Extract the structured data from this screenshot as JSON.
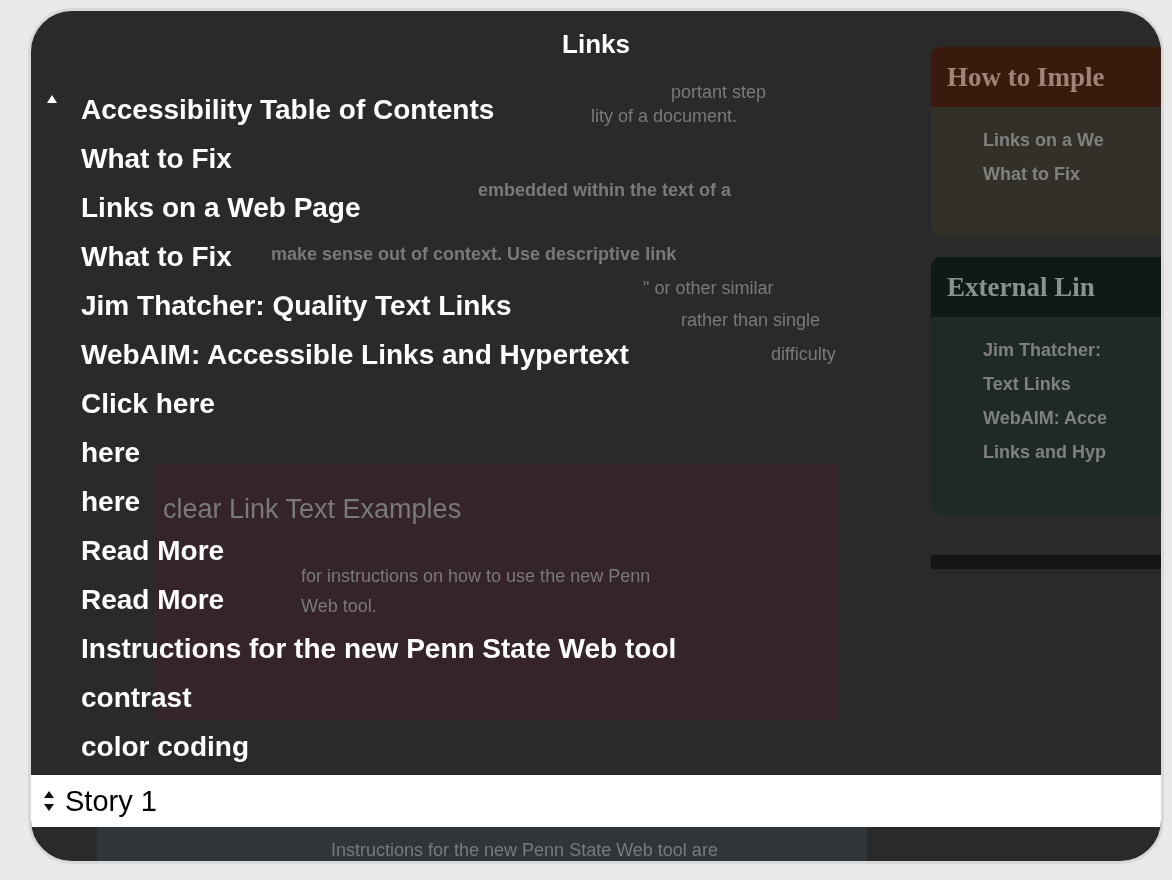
{
  "rotor": {
    "title": "Links",
    "items": [
      {
        "label": "Accessibility Table of Contents"
      },
      {
        "label": "What to Fix"
      },
      {
        "label": "Links on a Web Page"
      },
      {
        "label": "What to Fix"
      },
      {
        "label": "Jim Thatcher: Quality Text Links"
      },
      {
        "label": "WebAIM: Accessible Links and Hypertext"
      },
      {
        "label": "Click here"
      },
      {
        "label": "here"
      },
      {
        "label": "here"
      },
      {
        "label": "Read More"
      },
      {
        "label": "Read More"
      },
      {
        "label": "Instructions for the new Penn State Web tool"
      },
      {
        "label": "contrast"
      },
      {
        "label": "color coding"
      }
    ],
    "current": "Story 1"
  },
  "background_page": {
    "fragments": [
      {
        "text": "portant step"
      },
      {
        "text": "lity of a document."
      },
      {
        "text": "embedded within the text of a"
      },
      {
        "text": "make sense out of context. Use descriptive link"
      },
      {
        "text": "\" or other similar"
      },
      {
        "text": "rather than single"
      },
      {
        "text": "difficulty"
      },
      {
        "text": "clear Link Text Examples"
      },
      {
        "text": "for instructions on how to use the new Penn"
      },
      {
        "text": "Web tool."
      },
      {
        "text": "Instructions for the new Penn State Web tool are"
      }
    ],
    "cards": [
      {
        "title": "How to Imple",
        "color": "#3b1a0e",
        "items": [
          "Links on a We",
          "What to Fix"
        ]
      },
      {
        "title": "External Lin",
        "color": "#0f1a14",
        "items": [
          "Jim Thatcher:",
          "Text Links",
          "WebAIM: Acce",
          "Links and Hyp"
        ]
      }
    ]
  }
}
